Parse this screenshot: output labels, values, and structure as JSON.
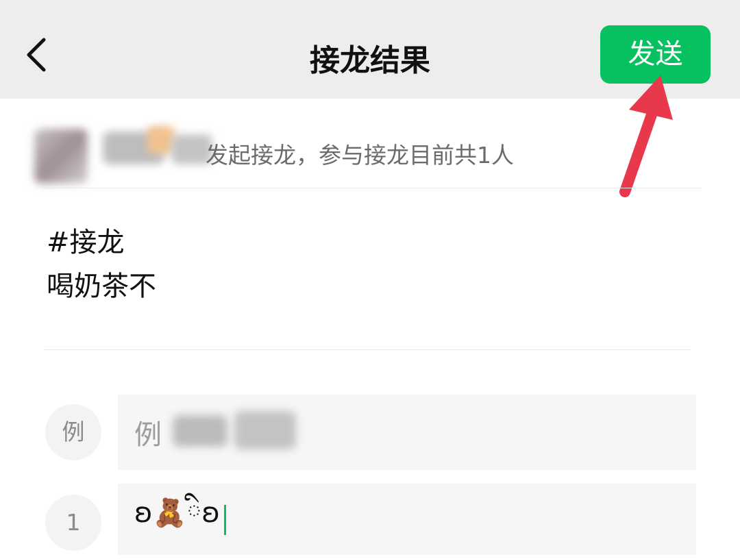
{
  "header": {
    "title": "接龙结果",
    "send_label": "发送",
    "back_icon": "chevron-left-icon"
  },
  "initiator": {
    "text": "发起接龙，参与接龙目前共1人"
  },
  "post": {
    "line1": "#接龙",
    "line2": "喝奶茶不"
  },
  "entries": {
    "example": {
      "number_label": "例",
      "text_prefix": "例"
    },
    "first": {
      "number_label": "1",
      "value": "ʚ🧸ིʚ"
    }
  },
  "colors": {
    "accent_green": "#07c160",
    "arrow_red": "#e8384b",
    "header_bg": "#ededed"
  }
}
